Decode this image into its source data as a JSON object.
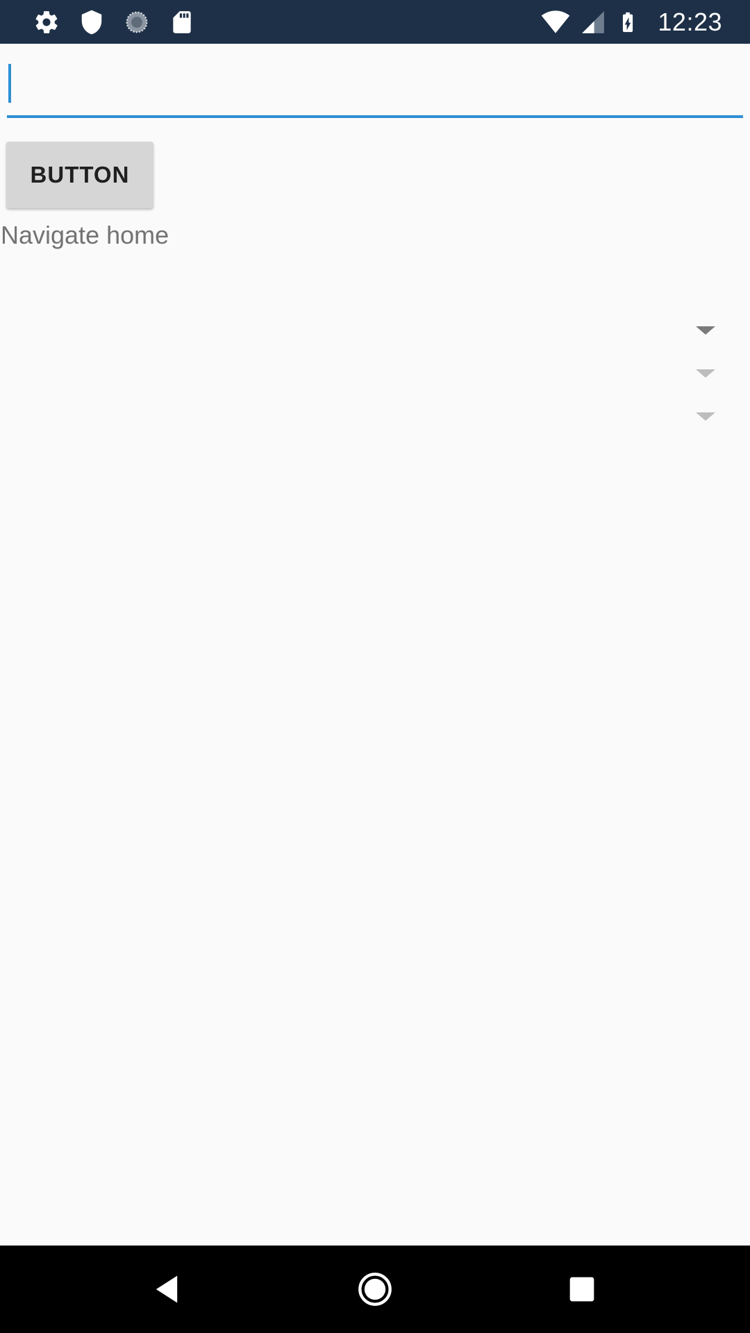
{
  "status_bar": {
    "time": "12:23",
    "left_icons": [
      "settings-icon",
      "shield-icon",
      "sync-progress-icon",
      "sd-card-icon"
    ],
    "right_icons": [
      "wifi-icon",
      "cell-signal-icon",
      "battery-charging-icon"
    ]
  },
  "input": {
    "value": "",
    "placeholder": "",
    "accent_color": "#2f8fd4"
  },
  "button": {
    "label": "BUTTON"
  },
  "navigate_label": "Navigate home",
  "spinners": [
    {
      "selected": "",
      "state": "enabled"
    },
    {
      "selected": "",
      "state": "disabled"
    },
    {
      "selected": "",
      "state": "disabled"
    }
  ],
  "nav_bar": {
    "buttons": [
      "back-icon",
      "home-icon",
      "recents-icon"
    ]
  },
  "colors": {
    "status_bar": "#1d3047",
    "background": "#fafafa",
    "button": "#d6d6d6",
    "nav_bar": "#000000"
  }
}
